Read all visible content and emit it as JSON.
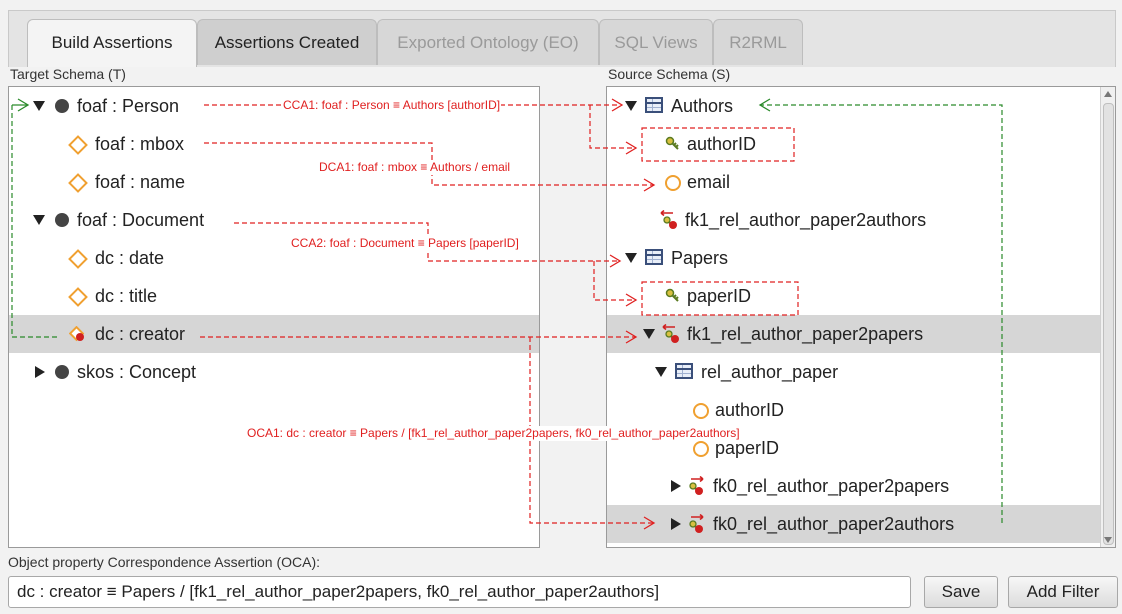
{
  "tabs": [
    {
      "label": "Build Assertions",
      "state": "active"
    },
    {
      "label": "Assertions Created",
      "state": "normal"
    },
    {
      "label": "Exported Ontology (EO)",
      "state": "disabled"
    },
    {
      "label": "SQL Views",
      "state": "disabled"
    },
    {
      "label": "R2RML",
      "state": "disabled"
    }
  ],
  "target": {
    "title": "Target Schema (T)",
    "rows": [
      {
        "label": "foaf : Person",
        "icon": "class-dot-icon",
        "expander": "expanded"
      },
      {
        "label": "foaf : mbox",
        "icon": "datatype-property-icon"
      },
      {
        "label": "foaf : name",
        "icon": "datatype-property-icon"
      },
      {
        "label": "foaf : Document",
        "icon": "class-dot-icon",
        "expander": "expanded"
      },
      {
        "label": "dc : date",
        "icon": "datatype-property-icon"
      },
      {
        "label": "dc : title",
        "icon": "datatype-property-icon"
      },
      {
        "label": "dc : creator",
        "icon": "object-property-icon",
        "selected": true
      },
      {
        "label": "skos : Concept",
        "icon": "class-dot-icon",
        "expander": "collapsed"
      }
    ]
  },
  "source": {
    "title": "Source Schema (S)",
    "rows": [
      {
        "label": "Authors",
        "icon": "table-icon",
        "expander": "expanded"
      },
      {
        "label": "authorID",
        "icon": "primary-key-icon"
      },
      {
        "label": "email",
        "icon": "column-icon"
      },
      {
        "label": "fk1_rel_author_paper2authors",
        "icon": "foreign-key-in-icon"
      },
      {
        "label": "Papers",
        "icon": "table-icon",
        "expander": "expanded"
      },
      {
        "label": "paperID",
        "icon": "primary-key-icon"
      },
      {
        "label": "fk1_rel_author_paper2papers",
        "icon": "foreign-key-in-icon",
        "expander": "expanded",
        "selected": true
      },
      {
        "label": "rel_author_paper",
        "icon": "table-icon",
        "expander": "expanded"
      },
      {
        "label": "authorID",
        "icon": "column-icon"
      },
      {
        "label": "paperID",
        "icon": "column-icon"
      },
      {
        "label": "fk0_rel_author_paper2papers",
        "icon": "foreign-key-out-icon",
        "expander": "collapsed"
      },
      {
        "label": "fk0_rel_author_paper2authors",
        "icon": "foreign-key-out-icon",
        "expander": "collapsed",
        "selected": true
      }
    ]
  },
  "annotations": {
    "cca1": "CCA1: foaf : Person ≡ Authors [authorID]",
    "dca1": "DCA1: foaf : mbox ≡ Authors / email",
    "cca2": "CCA2: foaf : Document ≡ Papers [paperID]",
    "oca1": "OCA1: dc : creator ≡ Papers / [fk1_rel_author_paper2papers, fk0_rel_author_paper2authors]"
  },
  "bottom": {
    "field_label": "Object property Correspondence Assertion (OCA):",
    "field_value": "dc : creator ≡ Papers / [fk1_rel_author_paper2papers, fk0_rel_author_paper2authors]",
    "save_label": "Save",
    "filter_label": "Add Filter"
  },
  "colors": {
    "annotation": "#e02020",
    "link": "#2a8a2a",
    "selection": "#d6d6d6"
  }
}
